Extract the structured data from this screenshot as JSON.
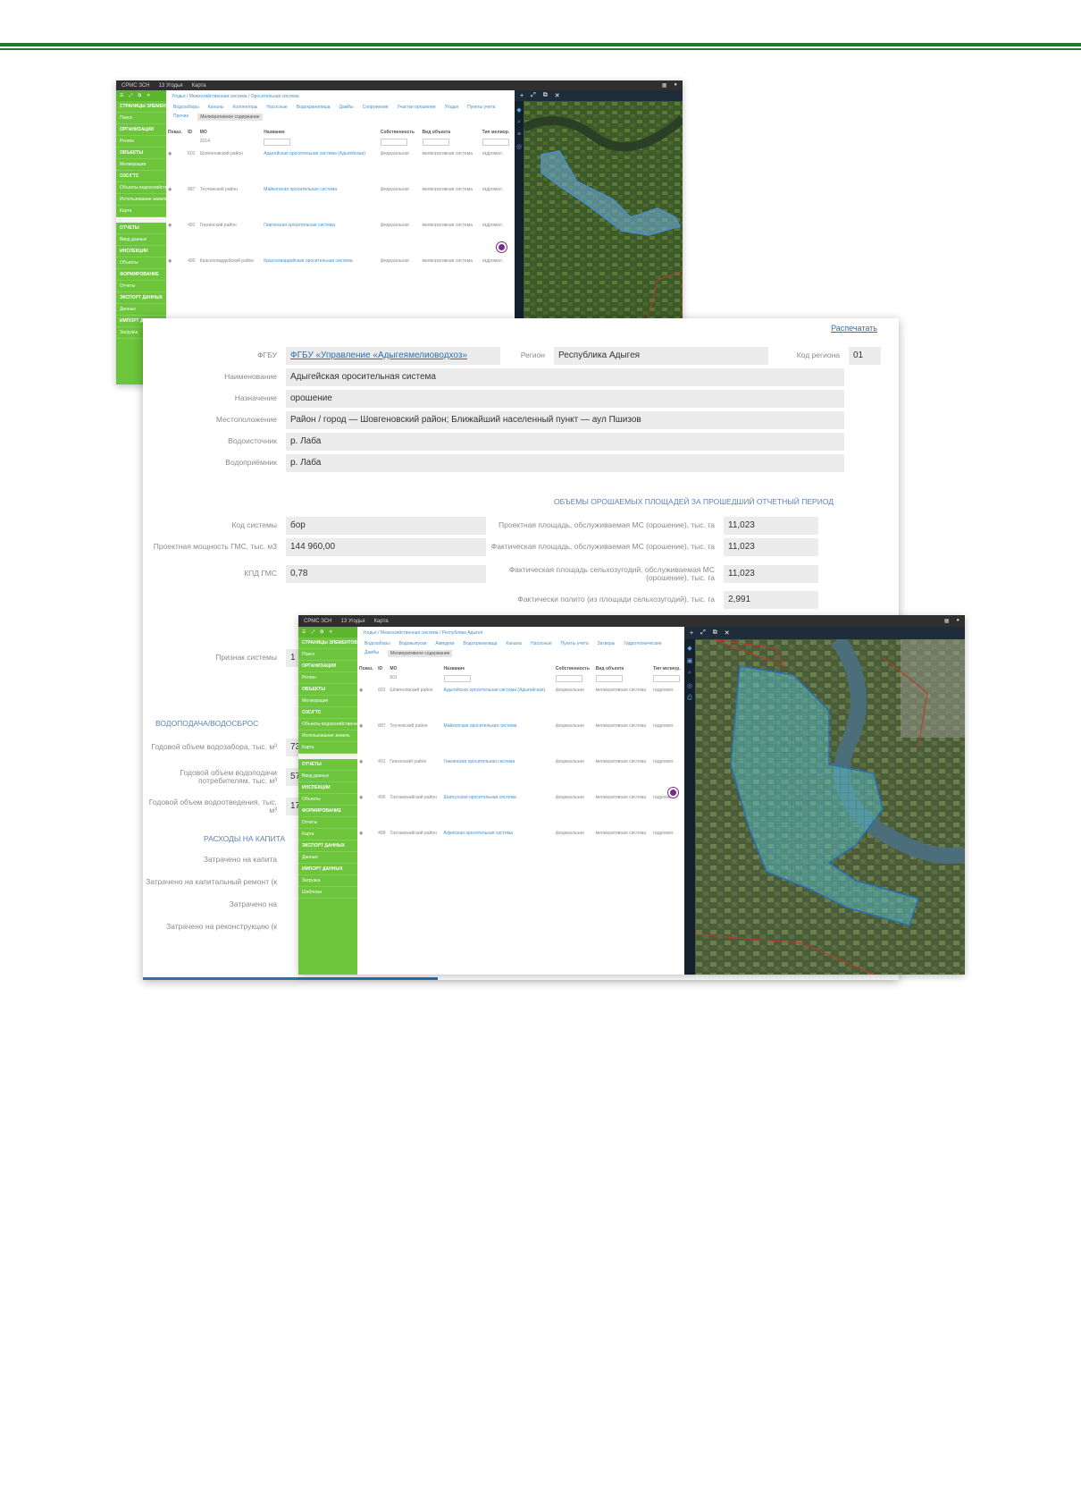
{
  "screen1": {
    "title": "СРМС ЗСН",
    "menu": [
      "13 Угодья",
      "Карта"
    ],
    "breadcrumb": "Угодья / Межхозяйственная система / Оросительная система",
    "tabs": [
      "Водозаборы",
      "Каналы",
      "Коллекторы",
      "Насосные",
      "Водохранилища",
      "Дамбы",
      "Сооружения",
      "Участки орошения",
      "Угодья",
      "Пункты учета",
      "Прочие",
      "Мелиоративное содержание"
    ],
    "columns": [
      "Показ.",
      "ID",
      "МО",
      "Название",
      "Собственность",
      "Вид объекта",
      "Тип мелиор."
    ],
    "filter_value": "2014",
    "rows": [
      [
        "601",
        "Шовгеновский район",
        "Адыгейская оросительная система (Адыгейская)",
        "федеральная",
        "мелиоративная система",
        "гидромел."
      ],
      [
        "887",
        "Теучежский район",
        "Майкопская оросительная система",
        "федеральная",
        "мелиоративная система",
        "гидромел."
      ],
      [
        "491",
        "Гиагинский район",
        "Гиагинская оросительная система",
        "федеральная",
        "мелиоративная система",
        "гидромел."
      ],
      [
        "490",
        "Красногвардейский район",
        "Красногвардейская оросительная система",
        "федеральная",
        "мелиоративная система",
        "гидромел."
      ]
    ],
    "sidebar": [
      "СТРАНИЦЫ ЭЛЕМЕНТОВ",
      "Поиск",
      "ОРГАНИЗАЦИИ",
      "Регион",
      "ОБЪЕКТЫ",
      "Мелиорация",
      "ОЗС/ГТС",
      "Объекты водохозяйственного комплекса",
      "Использование земель",
      "Карта",
      "ОТЧЕТЫ",
      "Ввод данных",
      "ИНСПЕКЦИИ",
      "Объекты",
      "ФОРМИРОВАНИЕ",
      "Отчеты",
      "ЭКСПОРТ ДАННЫХ",
      "Данные",
      "ИМПОРТ ДАННЫХ",
      "Загрузка"
    ]
  },
  "card": {
    "print": "Распечатать",
    "fgbu_label": "ФГБУ",
    "fgbu": "ФГБУ «Управление «Адыгеямелиоводхоз»",
    "region_label": "Регион",
    "region": "Республика Адыгея",
    "region_code_label": "Код региона",
    "region_code": "01",
    "fields": [
      {
        "label": "Наименование",
        "value": "Адыгейская оросительная система"
      },
      {
        "label": "Назначение",
        "value": "орошение"
      },
      {
        "label": "Местоположение",
        "value": "Район / город — Шовгеновский район; Ближайший населенный пункт — аул Пшизов"
      },
      {
        "label": "Водоисточник",
        "value": "р. Лаба"
      },
      {
        "label": "Водоприёмник",
        "value": "р. Лаба"
      }
    ],
    "areas_title": "ОБЪЕМЫ ОРОШАЕМЫХ ПЛОЩАДЕЙ ЗА ПРОШЕДШИЙ ОТЧЕТНЫЙ ПЕРИОД",
    "left_fields": [
      {
        "label": "Код системы",
        "value": "бор"
      },
      {
        "label": "Проектная мощность ГМС, тыс. м3",
        "value": "144 960,00"
      },
      {
        "label": "КПД ГМС",
        "value": "0,78"
      }
    ],
    "right_fields": [
      {
        "label": "Проектная площадь, обслуживаемая МС (орошение), тыс. га",
        "value": "11,023"
      },
      {
        "label": "Фактическая площадь, обслуживаемая МС (орошение), тыс. га",
        "value": "11,023"
      },
      {
        "label": "Фактическая площадь сельхозугодий, обслуживаемая МС (орошение), тыс. га",
        "value": "11,023"
      },
      {
        "label": "Фактически полито (из площади сельхозугодий), тыс. га",
        "value": "2,991"
      }
    ],
    "system_sign_label": "Признак системы",
    "system_sign_value": "1",
    "water_title": "ВОДОПОДАЧА/ВОДОСБРОС",
    "water_fields": [
      {
        "label": "Годовой объем водозабора, тыс. м³",
        "value": "73"
      },
      {
        "label": "Годовой объем водоподачи потребителям, тыс. м³",
        "value": "57"
      },
      {
        "label": "Годовой объем водоотведения, тыс. м³",
        "value": "17"
      }
    ],
    "costs_title": "РАСХОДЫ НА КАПИТА",
    "cost_fields": [
      {
        "label": "Затрачено на капита"
      },
      {
        "label": "Затрачено на капитальный ремонт (к"
      },
      {
        "label": "Затрачено на"
      },
      {
        "label": "Затрачено на реконструкцию (к"
      }
    ]
  },
  "screen2": {
    "title": "СРМС ЗСН",
    "menu": [
      "13 Угодья",
      "Карта"
    ],
    "breadcrumb": "Угодья / Межхозяйственная система / Республика Адыгея",
    "tabs": [
      "Водозаборы",
      "Водовыпуски",
      "Акведуки",
      "Водохранилища",
      "Каналы",
      "Насосные",
      "Пункты учета",
      "Затворы",
      "Гидротехнические",
      "Дамбы",
      "Мелиоративное содержание"
    ],
    "columns": [
      "Показ.",
      "ID",
      "МО",
      "Название",
      "Собственность",
      "Вид объекта",
      "Тип мелиор."
    ],
    "filter_value": "601",
    "rows": [
      [
        "601",
        "Шовгеновский район",
        "Адыгейская оросительная система (Адыгейская)",
        "федеральная",
        "мелиоративная система",
        "гидромел."
      ],
      [
        "887",
        "Теучежский район",
        "Майкопская оросительная система",
        "федеральная",
        "мелиоративная система",
        "гидромел."
      ],
      [
        "491",
        "Гиагинский район",
        "Гиагинская оросительная система",
        "федеральная",
        "мелиоративная система",
        "гидромел."
      ],
      [
        "490",
        "Тахтамукайский район",
        "Шапсугская оросительная система",
        "федеральная",
        "мелиоративная система",
        "гидромел."
      ],
      [
        "489",
        "Тахтамукайский район",
        "Афипская оросительная система",
        "федеральная",
        "мелиоративная система",
        "гидромел."
      ]
    ],
    "sidebar": [
      "СТРАНИЦЫ ЭЛЕМЕНТОВ",
      "Поиск",
      "ОРГАНИЗАЦИИ",
      "Регион",
      "ОБЪЕКТЫ",
      "Мелиорация",
      "ОЗС/ГТС",
      "Объекты водохозяйственного комплекса",
      "Использование земель",
      "Карта",
      "ОТЧЕТЫ",
      "Ввод данных",
      "ИНСПЕКЦИИ",
      "Объекты",
      "ФОРМИРОВАНИЕ",
      "Отчеты",
      "Карта",
      "ЭКСПОРТ ДАННЫХ",
      "Данные",
      "ИМПОРТ ДАННЫХ",
      "Загрузка",
      "Шаблоны"
    ]
  },
  "icons": {
    "menu": "menu-icon",
    "expand": "expand-icon",
    "popout": "popout-icon",
    "close": "close-icon",
    "user": "user-icon",
    "zoom": "zoom-icon",
    "layers": "layers-icon",
    "pin": "pin-icon"
  }
}
